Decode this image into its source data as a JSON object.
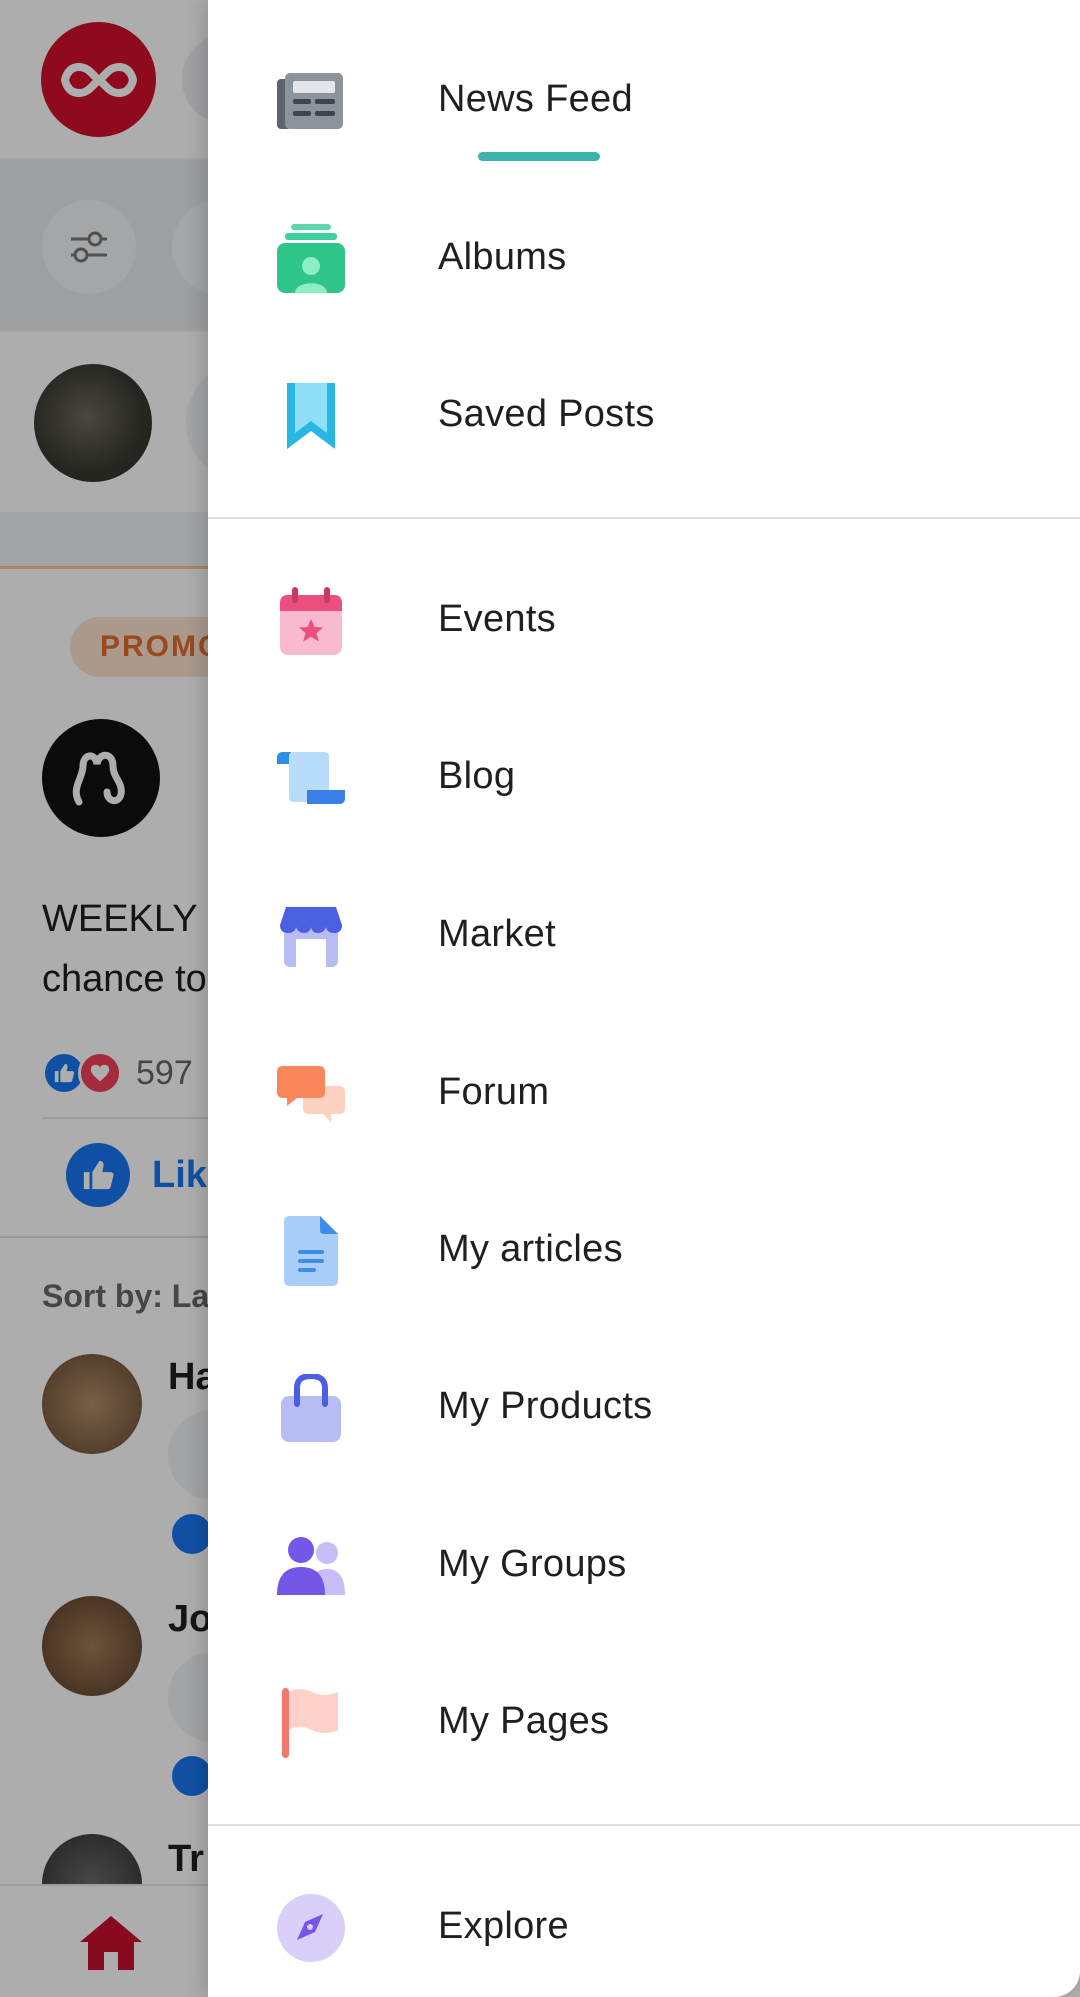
{
  "background": {
    "promo_badge": "PROMO",
    "post_text_line1": "WEEKLY",
    "post_text_line2": "chance to",
    "reaction_count": "597",
    "like_label": "Lik",
    "sort_label": "Sort by: Lat",
    "comments": [
      {
        "name_fragment": "Ha"
      },
      {
        "name_fragment": "Jo"
      },
      {
        "name_fragment": "Tr"
      }
    ]
  },
  "drawer": {
    "active_item": "News Feed",
    "accent_color": "#3cb4ac",
    "items": [
      {
        "label": "News Feed",
        "icon": "newspaper-icon"
      },
      {
        "label": "Albums",
        "icon": "albums-icon"
      },
      {
        "label": "Saved Posts",
        "icon": "bookmark-icon"
      },
      {
        "label": "Events",
        "icon": "calendar-icon"
      },
      {
        "label": "Blog",
        "icon": "scroll-icon"
      },
      {
        "label": "Market",
        "icon": "storefront-icon"
      },
      {
        "label": "Forum",
        "icon": "chat-bubbles-icon"
      },
      {
        "label": "My articles",
        "icon": "document-icon"
      },
      {
        "label": "My Products",
        "icon": "shopping-bag-icon"
      },
      {
        "label": "My Groups",
        "icon": "group-icon"
      },
      {
        "label": "My Pages",
        "icon": "flag-icon"
      },
      {
        "label": "Explore",
        "icon": "compass-icon"
      }
    ]
  }
}
